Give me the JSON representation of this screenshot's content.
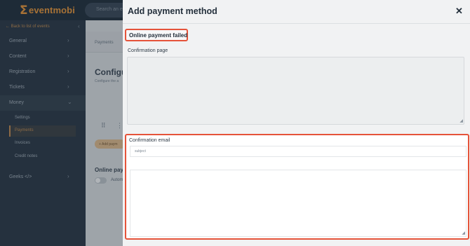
{
  "topbar": {
    "brand": "eventmobi",
    "brand_mark": "Σ",
    "search_placeholder": "Search an ev"
  },
  "sidebar": {
    "back_label": "← Back to list of events",
    "collapse_icon": "‹",
    "items": [
      {
        "label": "General"
      },
      {
        "label": "Content"
      },
      {
        "label": "Registration"
      },
      {
        "label": "Tickets"
      },
      {
        "label": "Money"
      },
      {
        "label": "Geeks </>"
      }
    ],
    "money_sub": [
      {
        "label": "Settings"
      },
      {
        "label": "Payments"
      },
      {
        "label": "Invoices"
      },
      {
        "label": "Credit notes"
      }
    ]
  },
  "main": {
    "breadcrumb": "Payments",
    "heading": "Configu",
    "subheading": "Configure the a",
    "add_button": "+ Add paym",
    "online_heading": "Online payı",
    "auto_label": "Autom"
  },
  "modal": {
    "title": "Add payment method",
    "close_icon": "✕",
    "section_title": "Online payment failed",
    "confirmation_page_label": "Confirmation page",
    "confirmation_email_label": "Confirmation email",
    "subject_placeholder": "subject"
  },
  "colors": {
    "highlight": "#e5533a",
    "accent": "#f29a38"
  }
}
